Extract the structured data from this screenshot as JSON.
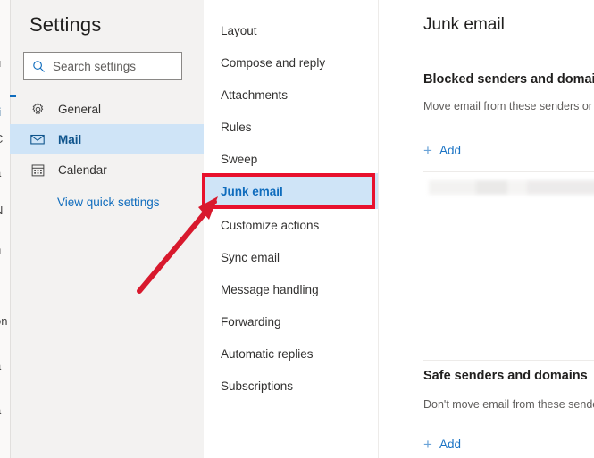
{
  "background_app": {
    "text_fragments": [
      "s",
      "u",
      "li",
      "C",
      "a",
      "N",
      "n",
      "r",
      "on",
      "a",
      "a"
    ]
  },
  "dialog": {
    "title": "Settings",
    "search": {
      "placeholder": "Search settings",
      "value": "",
      "icon": "search-icon"
    },
    "nav_items": [
      {
        "label": "General",
        "icon": "gear-icon",
        "selected": false
      },
      {
        "label": "Mail",
        "icon": "envelope-icon",
        "selected": true
      },
      {
        "label": "Calendar",
        "icon": "calendar-icon",
        "selected": false
      }
    ],
    "quick_settings_link": "View quick settings",
    "menu_items": [
      {
        "label": "Layout",
        "active": false
      },
      {
        "label": "Compose and reply",
        "active": false
      },
      {
        "label": "Attachments",
        "active": false
      },
      {
        "label": "Rules",
        "active": false
      },
      {
        "label": "Sweep",
        "active": false
      },
      {
        "label": "Junk email",
        "active": true
      },
      {
        "label": "Customize actions",
        "active": false
      },
      {
        "label": "Sync email",
        "active": false
      },
      {
        "label": "Message handling",
        "active": false
      },
      {
        "label": "Forwarding",
        "active": false
      },
      {
        "label": "Automatic replies",
        "active": false
      },
      {
        "label": "Subscriptions",
        "active": false
      }
    ],
    "content": {
      "title": "Junk email",
      "blocked": {
        "heading": "Blocked senders and domains",
        "description": "Move email from these senders or domains into",
        "add_label": "Add",
        "add_icon": "plus-icon"
      },
      "safe": {
        "heading": "Safe senders and domains",
        "description": "Don't move email from these senders or domains",
        "add_label": "Add",
        "add_icon": "plus-icon"
      }
    }
  },
  "annotations": {
    "highlight_color": "#e8112d",
    "arrow_color": "#d8192d",
    "target": "Junk email"
  },
  "colors": {
    "selection_blue": "#cfe4f7",
    "link_blue": "#0f6cbd",
    "nav_bg": "#f3f2f1",
    "text_primary": "#201f1e",
    "text_secondary": "#605e5c"
  }
}
